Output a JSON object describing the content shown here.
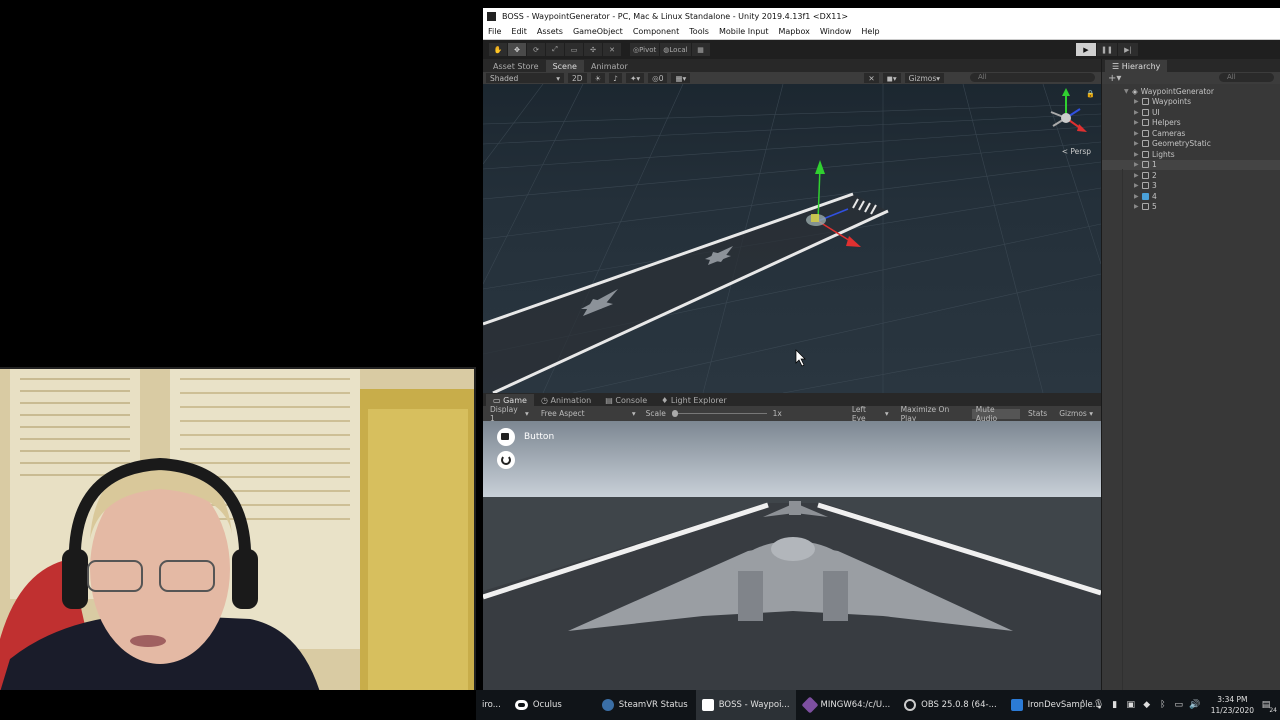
{
  "window": {
    "title": "BOSS - WaypointGenerator - PC, Mac & Linux Standalone - Unity 2019.4.13f1 <DX11>"
  },
  "menu": [
    "File",
    "Edit",
    "Assets",
    "GameObject",
    "Component",
    "Tools",
    "Mobile Input",
    "Mapbox",
    "Window",
    "Help"
  ],
  "toolbar": {
    "pivot_label": "Pivot",
    "local_label": "Local"
  },
  "scene_panel": {
    "tabs": [
      "Asset Store",
      "Scene",
      "Animator"
    ],
    "active_tab": "Scene",
    "shading_mode": "Shaded",
    "mode_2d": "2D",
    "gizmos_label": "Gizmos",
    "search_placeholder": "All",
    "persp_label": "< Persp",
    "fx_count": "0"
  },
  "game_panel": {
    "tabs": [
      "Game",
      "Animation",
      "Console",
      "Light Explorer"
    ],
    "display": "Display 1",
    "aspect": "Free Aspect",
    "scale_label": "Scale",
    "scale_value": "1x",
    "eye": "Left Eye",
    "maximize": "Maximize On Play",
    "mute": "Mute Audio",
    "stats": "Stats",
    "gizmos": "Gizmos",
    "ui_button_label": "Button"
  },
  "hierarchy": {
    "tab": "Hierarchy",
    "search_placeholder": "All",
    "root": "WaypointGenerator",
    "items": [
      {
        "label": "Waypoints",
        "prefab": false
      },
      {
        "label": "UI",
        "prefab": false
      },
      {
        "label": "Helpers",
        "prefab": false
      },
      {
        "label": "Cameras",
        "prefab": false
      },
      {
        "label": "GeometryStatic",
        "prefab": false
      },
      {
        "label": "Lights",
        "prefab": false
      },
      {
        "label": "1",
        "prefab": false,
        "selected": true
      },
      {
        "label": "2",
        "prefab": false
      },
      {
        "label": "3",
        "prefab": false
      },
      {
        "label": "4",
        "prefab": true
      },
      {
        "label": "5",
        "prefab": false
      }
    ]
  },
  "taskbar": {
    "items": [
      {
        "label": "iro...",
        "color": "#c0392b"
      },
      {
        "label": "Oculus",
        "color": "#ffffff"
      },
      {
        "label": "SteamVR Status",
        "color": "#3a6ea5"
      },
      {
        "label": "BOSS - Waypoi...",
        "color": "#ffffff",
        "active": true
      },
      {
        "label": "MINGW64:/c/U...",
        "color": "#7d4fa0"
      },
      {
        "label": "OBS 25.0.8 (64-...",
        "color": "#cccccc"
      },
      {
        "label": "IronDevSample...",
        "color": "#2b7bd6"
      }
    ],
    "time": "3:34 PM",
    "date": "11/23/2020",
    "notifications": "24"
  },
  "colors": {
    "axis_x": "#e03030",
    "axis_y": "#30d030",
    "axis_z": "#3050e0"
  }
}
